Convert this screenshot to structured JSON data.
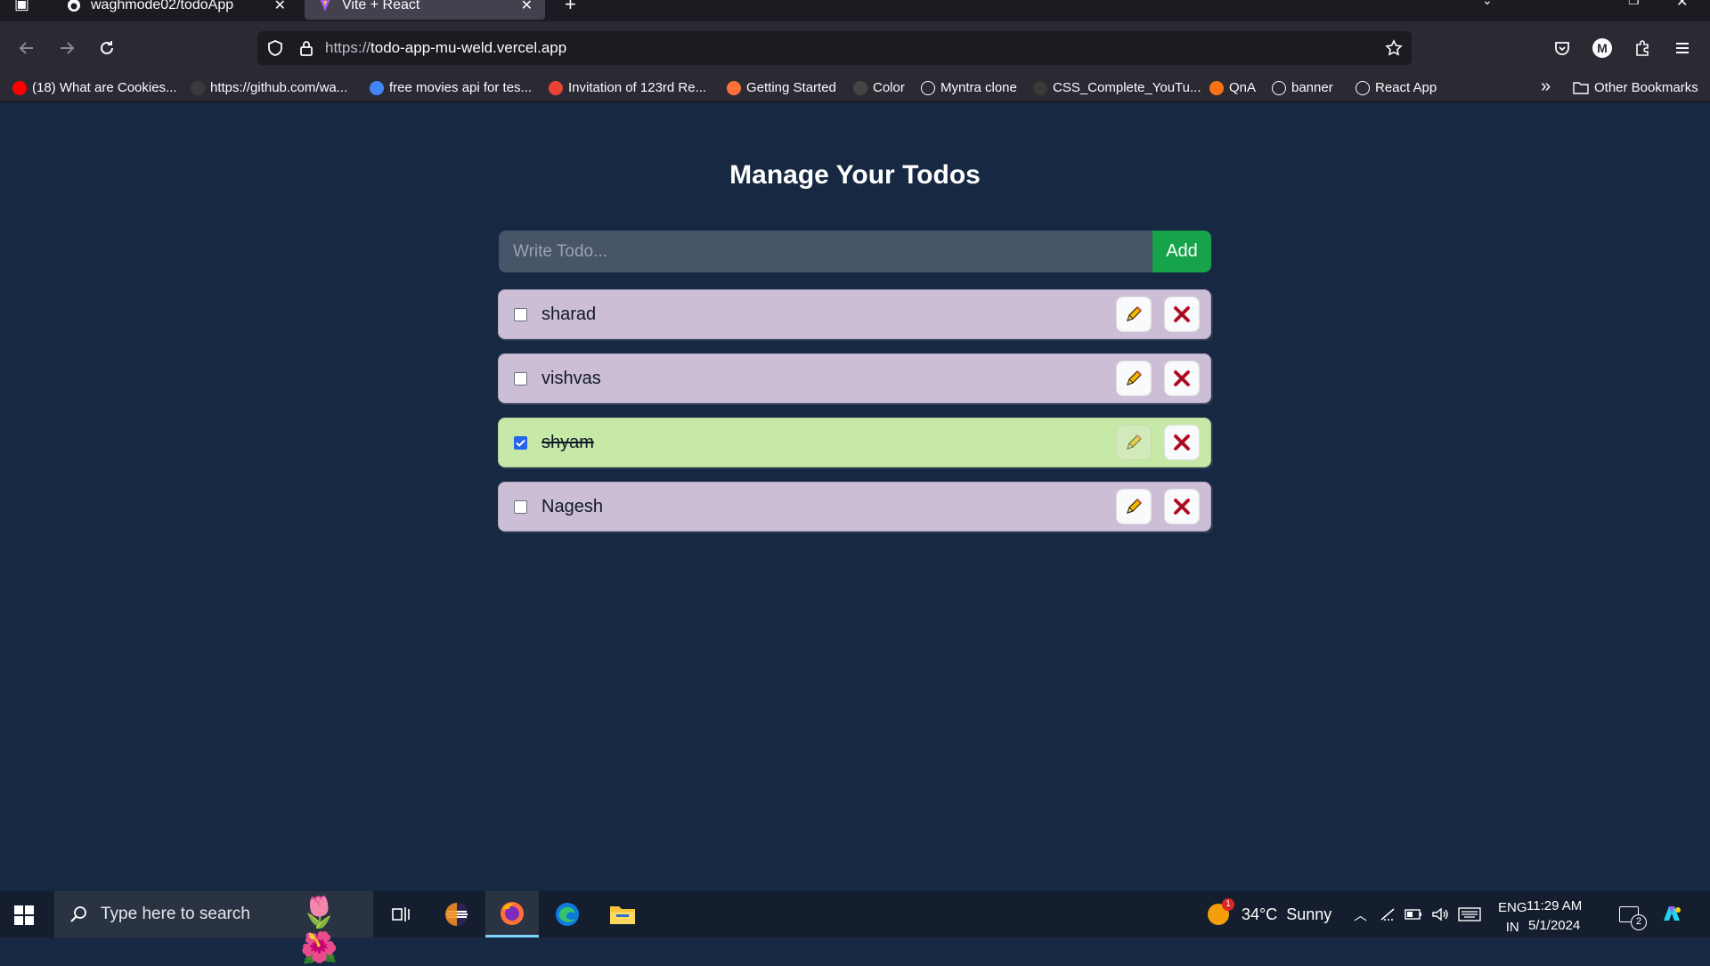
{
  "browser": {
    "tabs": [
      {
        "title": "waghmode02/todoApp",
        "active": false
      },
      {
        "title": "Vite + React",
        "active": true
      }
    ],
    "url": {
      "scheme": "https://",
      "host": "todo-app-mu-weld.vercel.app"
    },
    "profile_initial": "M",
    "bookmarks": [
      {
        "label": "(18) What are Cookies...",
        "icon": "youtube-icon",
        "color": "#ff0000"
      },
      {
        "label": "https://github.com/wa...",
        "icon": "github-icon",
        "color": "#3a3a3a"
      },
      {
        "label": "free movies api for tes...",
        "icon": "google-icon",
        "color": "#4285f4"
      },
      {
        "label": "Invitation of 123rd Re...",
        "icon": "gmail-icon",
        "color": "#ea4335"
      },
      {
        "label": "Getting Started",
        "icon": "firefox-icon",
        "color": "#ff7139"
      },
      {
        "label": "Color",
        "icon": "color-icon",
        "color": "#444444"
      },
      {
        "label": "Myntra clone",
        "icon": "globe-icon",
        "color": "transparent"
      },
      {
        "label": "CSS_Complete_YouTu...",
        "icon": "github-icon",
        "color": "#3a3a3a"
      },
      {
        "label": "QnA",
        "icon": "qna-icon",
        "color": "#f97316"
      },
      {
        "label": "banner",
        "icon": "globe-icon",
        "color": "transparent"
      },
      {
        "label": "React App",
        "icon": "react-icon",
        "color": "transparent"
      }
    ],
    "other_bookmarks": "Other Bookmarks"
  },
  "app": {
    "title": "Manage Your Todos",
    "input": {
      "placeholder": "Write Todo...",
      "value": ""
    },
    "add_label": "Add",
    "todos": [
      {
        "text": "sharad",
        "completed": false
      },
      {
        "text": "vishvas",
        "completed": false
      },
      {
        "text": "shyam",
        "completed": true
      },
      {
        "text": "Nagesh",
        "completed": false
      }
    ],
    "colors": {
      "item": "#ccbed7",
      "item_done": "#c6e9a7",
      "add": "#16a34a",
      "background": "#172842"
    }
  },
  "taskbar": {
    "search_placeholder": "Type here to search",
    "weather": {
      "temp": "34°C",
      "condition": "Sunny",
      "badge": "1"
    },
    "language": {
      "lang": "ENG",
      "region": "IN"
    },
    "time": "11:29 AM",
    "date": "5/1/2024",
    "notifications": "2"
  }
}
